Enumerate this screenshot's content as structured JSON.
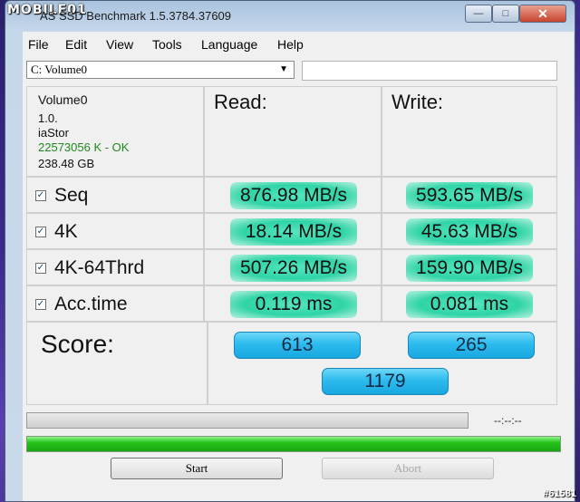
{
  "window": {
    "title": "AS SSD Benchmark 1.5.3784.37609",
    "logo_text": "MOBILE01"
  },
  "menu": [
    "File",
    "Edit",
    "View",
    "Tools",
    "Language",
    "Help"
  ],
  "drive": {
    "selected": "C: Volume0",
    "info": [
      "Volume0",
      "1.0.",
      "iaStor",
      "22573056 K - OK",
      "238.48 GB"
    ],
    "ok_color": "#1f8a1f"
  },
  "headers": {
    "read": "Read:",
    "write": "Write:"
  },
  "rows": [
    {
      "label": "Seq",
      "checked": true,
      "read": "876.98 MB/s",
      "write": "593.65 MB/s"
    },
    {
      "label": "4K",
      "checked": true,
      "read": "18.14 MB/s",
      "write": "45.63 MB/s"
    },
    {
      "label": "4K-64Thrd",
      "checked": true,
      "read": "507.26 MB/s",
      "write": "159.90 MB/s"
    },
    {
      "label": "Acc.time",
      "checked": true,
      "read": "0.119 ms",
      "write": "0.081 ms"
    }
  ],
  "score": {
    "label": "Score:",
    "read": "613",
    "write": "265",
    "total": "1179"
  },
  "progress": {
    "time": "--:--:--",
    "test_progress": 0,
    "overall_progress": 1.0
  },
  "buttons": {
    "start": "Start",
    "abort": "Abort"
  },
  "watermark": "#61581"
}
